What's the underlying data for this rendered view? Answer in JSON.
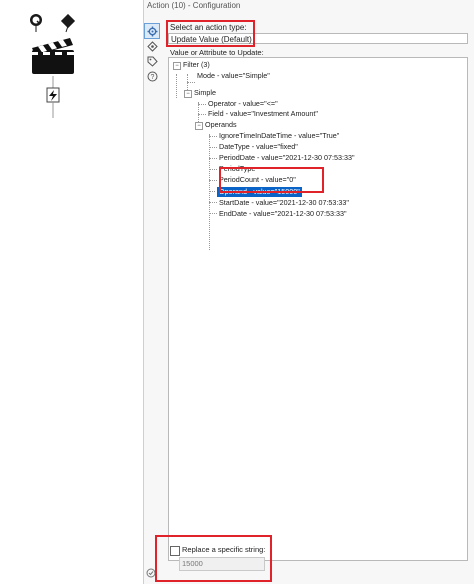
{
  "window": {
    "title": "Action (10) - Configuration"
  },
  "config": {
    "action_type_label": "Select an action type:",
    "action_type_value": "Update Value (Default)",
    "attribute_label": "Value or Attribute to Update:",
    "tree": [
      {
        "label": "Filter (3)",
        "toggle": "−"
      },
      {
        "label": "Mode - value=\"Simple\""
      },
      {
        "label": "Simple",
        "toggle": "−"
      },
      {
        "label": "Operator - value=\"<=\""
      },
      {
        "label": "Field - value=\"Investment Amount\""
      },
      {
        "label": "Operands",
        "toggle": "−"
      },
      {
        "label": "IgnoreTimeInDateTime - value=\"True\""
      },
      {
        "label": "DateType - value=\"fixed\""
      },
      {
        "label": "PeriodDate - value=\"2021-12-30 07:53:33\""
      },
      {
        "label": "PeriodType"
      },
      {
        "label": "PeriodCount - value=\"0\""
      },
      {
        "label": "Operand - value=\"15000\"",
        "selected": true
      },
      {
        "label": "StartDate - value=\"2021-12-30 07:53:33\""
      },
      {
        "label": "EndDate - value=\"2021-12-30 07:53:33\""
      }
    ],
    "replace_label": "Replace a specific string:",
    "replace_value": "15000",
    "replace_checked": false
  },
  "icons": {
    "tool": "action-clapperboard-icon",
    "side": [
      "gear-icon",
      "connection-icon",
      "tag-icon",
      "help-icon"
    ]
  },
  "colors": {
    "highlight_box": "#e0222a",
    "selection": "#0a64c8"
  }
}
